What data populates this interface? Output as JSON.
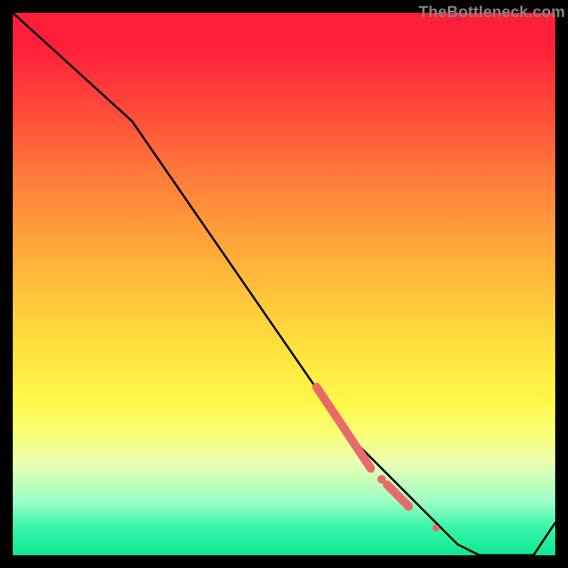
{
  "watermark": "TheBottleneck.com",
  "chart_data": {
    "type": "line",
    "title": "",
    "xlabel": "",
    "ylabel": "",
    "xlim": [
      0,
      100
    ],
    "ylim": [
      0,
      100
    ],
    "series": [
      {
        "name": "bottleneck-curve",
        "x": [
          0,
          22,
          62,
          75,
          82,
          86,
          90,
          92,
          96,
          100
        ],
        "values": [
          100,
          80,
          22,
          9,
          2,
          0,
          0,
          0,
          0,
          6
        ]
      }
    ],
    "markers": [
      {
        "name": "segment-a-start",
        "x": 56,
        "y": 31
      },
      {
        "name": "segment-a-end",
        "x": 66,
        "y": 16
      },
      {
        "name": "dot-mid",
        "x": 68,
        "y": 14
      },
      {
        "name": "segment-b-start",
        "x": 69,
        "y": 13
      },
      {
        "name": "segment-b-end",
        "x": 73,
        "y": 9
      },
      {
        "name": "dot-low",
        "x": 78,
        "y": 5
      }
    ],
    "colors": {
      "line": "#000000",
      "marker": "#e86a6a"
    }
  }
}
